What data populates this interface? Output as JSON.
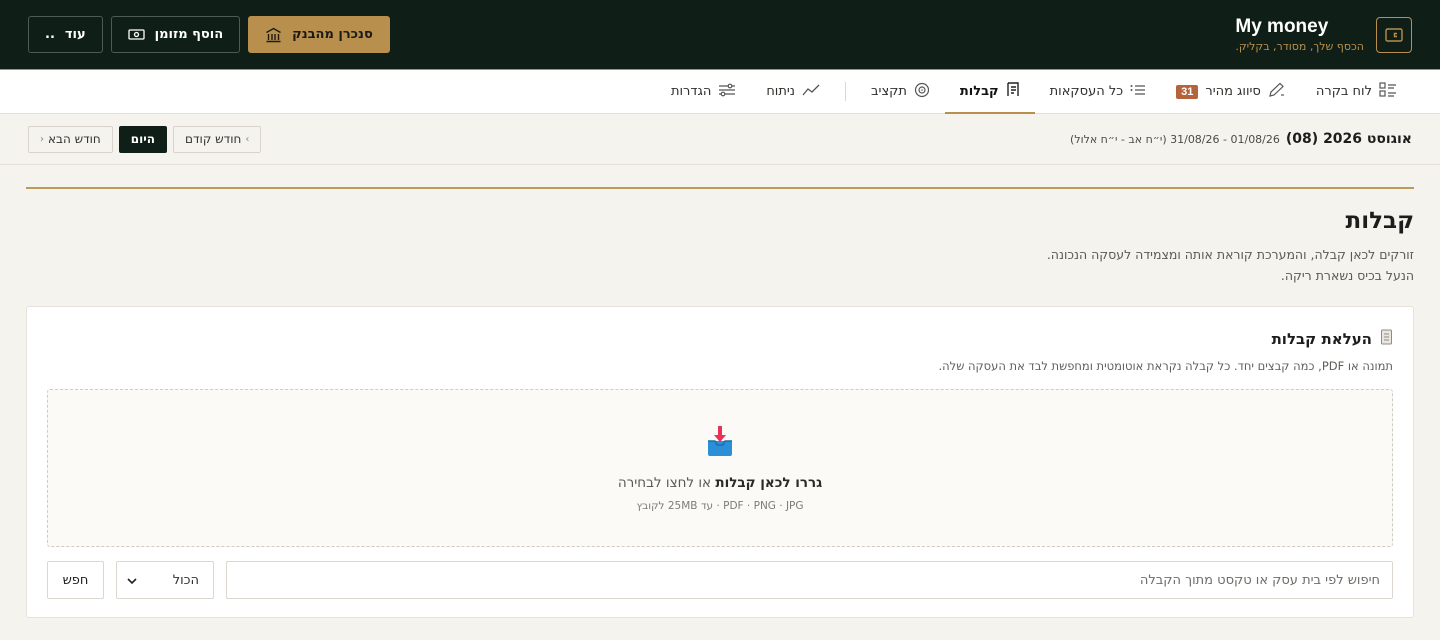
{
  "header": {
    "title": "My money",
    "tagline": "הכסף שלך, מסודר, בקליק.",
    "actions": {
      "sync_label": "סנכרן מהבנק",
      "add_cash_label": "הוסף מזומן",
      "more_label": "עוד",
      "more_dots": ".."
    }
  },
  "nav": {
    "items": [
      {
        "label": "לוח בקרה"
      },
      {
        "label": "סיווג מהיר",
        "badge": "31"
      },
      {
        "label": "כל העסקאות"
      },
      {
        "label": "קבלות"
      },
      {
        "label": "תקציב"
      },
      {
        "label": "ניתוח"
      },
      {
        "label": "הגדרות"
      }
    ]
  },
  "period": {
    "title": "אוגוסט 2026 (08)",
    "range": "01/08/26 - 31/08/26 (י״ח אב - י״ח אלול)",
    "prev_label": "חודש קודם",
    "today_label": "היום",
    "next_label": "חודש הבא"
  },
  "page": {
    "title": "קבלות",
    "description": "זורקים לכאן קבלה, והמערכת קוראת אותה ומצמידה לעסקה הנכונה. הנעל בכיס נשארת ריקה."
  },
  "upload": {
    "title": "העלאת קבלות",
    "subtitle": "תמונה או PDF, כמה קבצים יחד. כל קבלה נקראת אוטומטית ומחפשת לבד את העסקה שלה.",
    "drop_bold": "גררו לכאן קבלות",
    "drop_rest": "או לחצו לבחירה",
    "formats": "PDF · PNG · JPG · עד 25MB לקובץ"
  },
  "search": {
    "placeholder": "חיפוש לפי בית עסק או טקסט מתוך הקבלה",
    "filter_value": "הכול",
    "button_label": "חפש"
  },
  "colors": {
    "header_bg": "#0f1f18",
    "accent_gold": "#b88f4d",
    "badge": "#b5633a"
  }
}
